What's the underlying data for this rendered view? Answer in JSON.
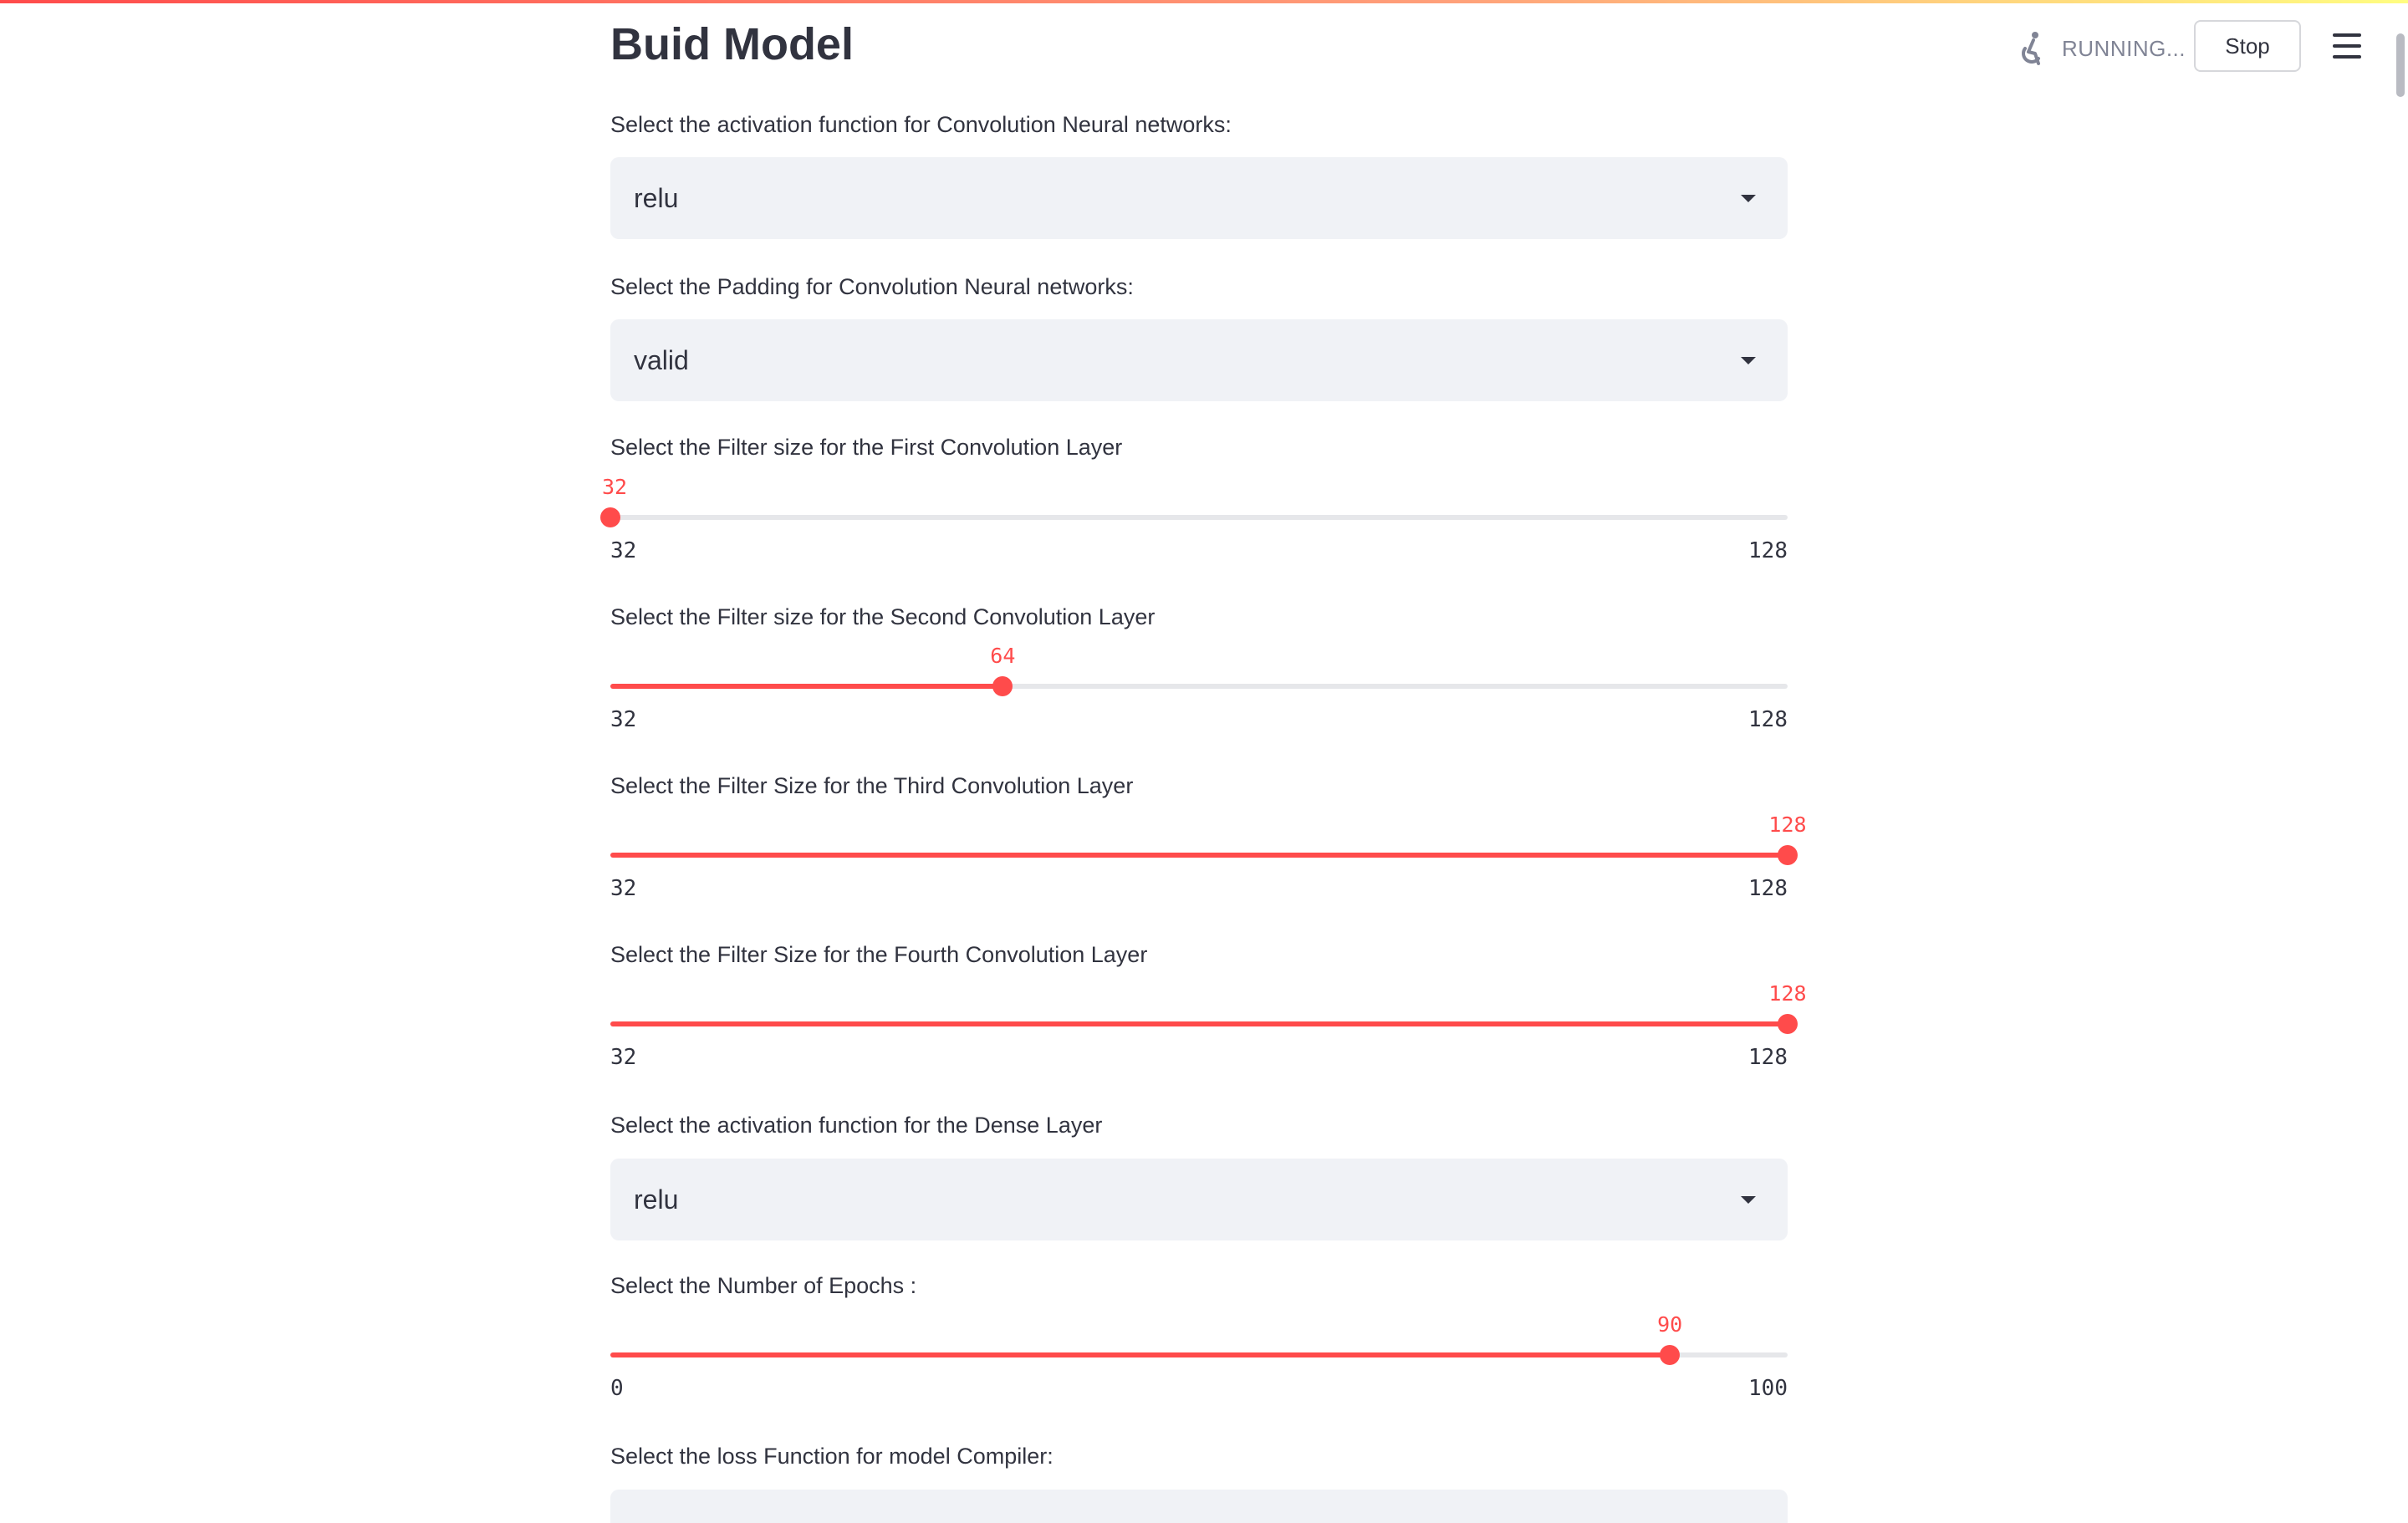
{
  "header": {
    "status_text": "RUNNING...",
    "stop_label": "Stop"
  },
  "page": {
    "title": "Buid Model"
  },
  "colors": {
    "accent": "#ff4b4b",
    "select_bg": "#f0f2f6",
    "track": "#e6e7ea",
    "text": "#31333f"
  },
  "widgets": {
    "conv_activation": {
      "label": "Select the activation function for Convolution Neural networks:",
      "value": "relu"
    },
    "conv_padding": {
      "label": "Select the Padding for Convolution Neural networks:",
      "value": "valid"
    },
    "filter1": {
      "label": "Select the Filter size for the First Convolution Layer",
      "value": 32,
      "min": 32,
      "max": 128
    },
    "filter2": {
      "label": "Select the Filter size for the Second Convolution Layer",
      "value": 64,
      "min": 32,
      "max": 128
    },
    "filter3": {
      "label": "Select the Filter Size for the Third Convolution Layer",
      "value": 128,
      "min": 32,
      "max": 128
    },
    "filter4": {
      "label": "Select the Filter Size for the Fourth Convolution Layer",
      "value": 128,
      "min": 32,
      "max": 128
    },
    "dense_activation": {
      "label": "Select the activation function for the Dense Layer",
      "value": "relu"
    },
    "epochs": {
      "label": "Select the Number of Epochs :",
      "value": 90,
      "min": 0,
      "max": 100
    },
    "loss_function": {
      "label": "Select the loss Function for model Compiler:"
    }
  }
}
